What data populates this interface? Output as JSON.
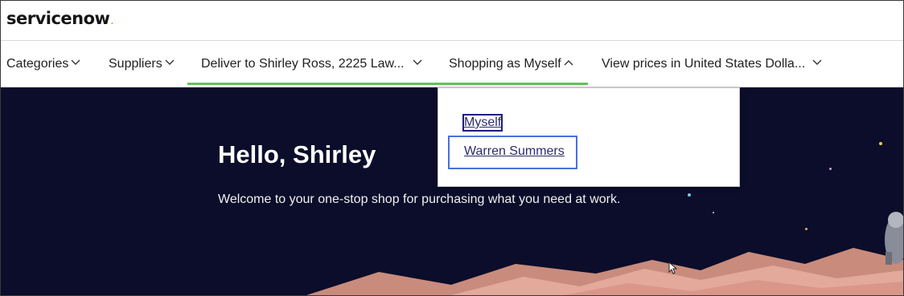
{
  "header": {
    "logo_text": "servicenow",
    "logo_dot": "."
  },
  "nav": {
    "items": [
      {
        "label": "Categories",
        "icon": "chevron-down-icon"
      },
      {
        "label": "Suppliers",
        "icon": "chevron-down-icon"
      },
      {
        "label": "Deliver to Shirley Ross, 2225 Law...",
        "icon": "chevron-down-icon"
      },
      {
        "label": "Shopping as Myself",
        "icon": "chevron-up-icon"
      },
      {
        "label": "View prices in United States Dolla...",
        "icon": "chevron-down-icon"
      }
    ],
    "active_color": "#62c35a"
  },
  "hero": {
    "title": "Hello, Shirley",
    "subtitle": "Welcome to your one-stop shop for purchasing what you need at work.",
    "background": "#0b0d2a"
  },
  "dropdown": {
    "options": [
      "Myself",
      "Warren Summers"
    ],
    "highlight_color": "#4a6fdc"
  }
}
